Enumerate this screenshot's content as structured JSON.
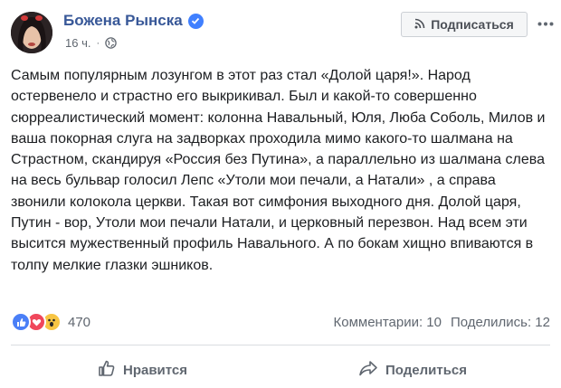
{
  "author": {
    "name": "Божена Рынска",
    "timestamp": "16 ч."
  },
  "header": {
    "subscribe_label": "Подписаться"
  },
  "post": {
    "text": "Самым популярным лозунгом в этот раз стал «Долой царя!». Народ остервенело и страстно его выкрикивал. Был и какой-то совершенно сюрреалистический момент: колонна Навальный, Юля, Люба Соболь, Милов и ваша покорная слуга на задворках проходила мимо какого-то шалмана на Страстном, скандируя «Россия без Путина», а параллельно из шалмана слева на весь бульвар голосил Лепс «Утоли мои печали, а Натали» , а справа звонили колокола церкви. Такая вот симфония выходного дня. Долой царя, Путин - вор, Утоли мои печали Натали, и церковный перезвон. Над всем эти высится мужественный профиль Навального. А по бокам хищно впиваются в толпу мелкие глазки эшников."
  },
  "reactions": {
    "count": "470",
    "icons": [
      "like-icon",
      "love-icon",
      "wow-icon"
    ]
  },
  "stats": {
    "comments": "Комментарии: 10",
    "shares": "Поделились: 12"
  },
  "actions": {
    "like_label": "Нравится",
    "share_label": "Поделиться"
  },
  "colors": {
    "author": "#385898",
    "secondary": "#606770",
    "like": "#4a7ff7",
    "love": "#f0475b",
    "wow": "#f7c544"
  }
}
